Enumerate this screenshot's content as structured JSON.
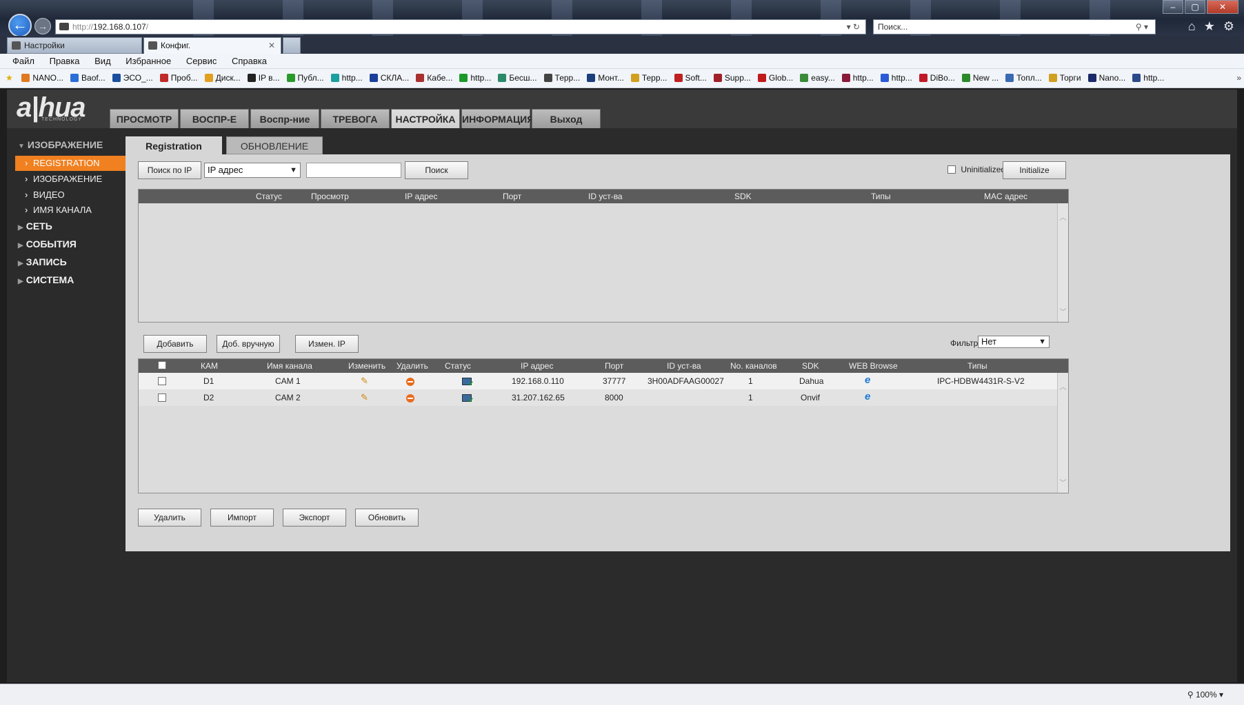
{
  "browser": {
    "address_prefix": "http://",
    "address_host": "192.168.0.107",
    "address_suffix": "/",
    "search_placeholder": "Поиск...",
    "tabs": [
      {
        "label": "Настройки"
      },
      {
        "label": "Конфиг."
      }
    ],
    "menu": [
      "Файл",
      "Правка",
      "Вид",
      "Избранное",
      "Сервис",
      "Справка"
    ],
    "favorites": [
      "NANO...",
      "Baof...",
      "ЭСО_...",
      "Проб...",
      "Диск...",
      "IP в...",
      "Публ...",
      "http...",
      "СКЛА...",
      "Кабе...",
      "http...",
      "Бесш...",
      "Терр...",
      "Монт...",
      "Терр...",
      "Soft...",
      "Supp...",
      "Glob...",
      "easy...",
      "http...",
      "http...",
      "DiBo...",
      "New ...",
      "Топл...",
      "Торги",
      "Nano...",
      "http..."
    ],
    "zoom": "100%"
  },
  "app": {
    "logo": "a|hua",
    "logo_sub": "TECHNOLOGY",
    "main_tabs": [
      {
        "label": "ПРОСМОТР"
      },
      {
        "label": "ВОСПР-Е"
      },
      {
        "label": "Воспр-ние"
      },
      {
        "label": "ТРЕВОГА"
      },
      {
        "label": "НАСТРОЙКА",
        "active": true
      },
      {
        "label": "ИНФОРМАЦИЯ"
      },
      {
        "label": "Выход"
      }
    ],
    "sidebar": {
      "top_group": "ИЗОБРАЖЕНИЕ",
      "items": [
        {
          "label": "REGISTRATION",
          "active": true
        },
        {
          "label": "ИЗОБРАЖЕНИЕ"
        },
        {
          "label": "ВИДЕО"
        },
        {
          "label": "ИМЯ КАНАЛА"
        }
      ],
      "groups": [
        "СЕТЬ",
        "СОБЫТИЯ",
        "ЗАПИСЬ",
        "СИСТЕМА"
      ]
    },
    "sub_tabs": [
      "Registration",
      "ОБНОВЛЕНИЕ"
    ],
    "search": {
      "search_by_ip_label": "Поиск по IP",
      "mode_value": "IP адрес",
      "search_button": "Поиск",
      "uninitialized_label": "Uninitialized",
      "initialize_button": "Initialize"
    },
    "found_table": {
      "columns": [
        "Статус",
        "Просмотр",
        "IP адрес",
        "Порт",
        "ID уст-ва",
        "SDK",
        "Типы",
        "MAC адрес"
      ]
    },
    "mid_buttons": {
      "add": "Добавить",
      "add_manual": "Доб. вручную",
      "change_ip": "Измен. IP",
      "filter_label": "Фильтр",
      "filter_value": "Нет"
    },
    "added_table": {
      "columns": [
        "КАМ",
        "Имя канала",
        "Изменить",
        "Удалить",
        "Статус",
        "IP адрес",
        "Порт",
        "ID уст-ва",
        "No. каналов",
        "SDK",
        "WEB Browse",
        "Типы"
      ],
      "rows": [
        {
          "cam": "D1",
          "name": "CAM 1",
          "ip": "192.168.0.110",
          "port": "37777",
          "id": "3H00ADFAAG00027",
          "channels": "1",
          "sdk": "Dahua",
          "type": "IPC-HDBW4431R-S-V2"
        },
        {
          "cam": "D2",
          "name": "CAM 2",
          "ip": "31.207.162.65",
          "port": "8000",
          "id": "",
          "channels": "1",
          "sdk": "Onvif",
          "type": ""
        }
      ]
    },
    "bottom_buttons": {
      "delete": "Удалить",
      "import": "Импорт",
      "export": "Экспорт",
      "refresh": "Обновить"
    }
  }
}
